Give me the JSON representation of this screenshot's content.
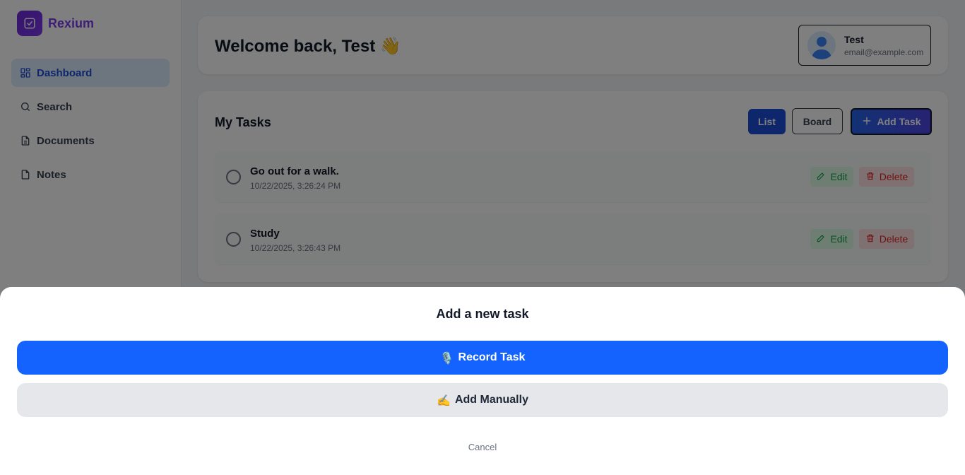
{
  "app": {
    "name": "Rexium"
  },
  "sidebar": {
    "items": [
      {
        "label": "Dashboard",
        "icon": "dashboard-icon",
        "active": true
      },
      {
        "label": "Search",
        "icon": "search-icon",
        "active": false
      },
      {
        "label": "Documents",
        "icon": "document-icon",
        "active": false
      },
      {
        "label": "Notes",
        "icon": "note-icon",
        "active": false
      }
    ]
  },
  "header": {
    "welcome": "Welcome back, Test 👋",
    "user": {
      "name": "Test",
      "email": "email@example.com"
    }
  },
  "tasks": {
    "title": "My Tasks",
    "list_label": "List",
    "board_label": "Board",
    "add_label": "Add Task",
    "items": [
      {
        "title": "Go out for a walk.",
        "time": "10/22/2025, 3:26:24 PM",
        "edit": "Edit",
        "delete": "Delete"
      },
      {
        "title": "Study",
        "time": "10/22/2025, 3:26:43 PM",
        "edit": "Edit",
        "delete": "Delete"
      }
    ]
  },
  "sheet": {
    "title": "Add a new task",
    "record": {
      "emoji": "🎙️",
      "label": "Record Task"
    },
    "manual": {
      "emoji": "✍️",
      "label": "Add Manually"
    },
    "cancel": "Cancel"
  },
  "colors": {
    "brand": "#7c3aed",
    "primary": "#1463ff",
    "active_nav_bg": "#dbeafe",
    "edit": "#16a34a",
    "delete": "#dc2626"
  }
}
